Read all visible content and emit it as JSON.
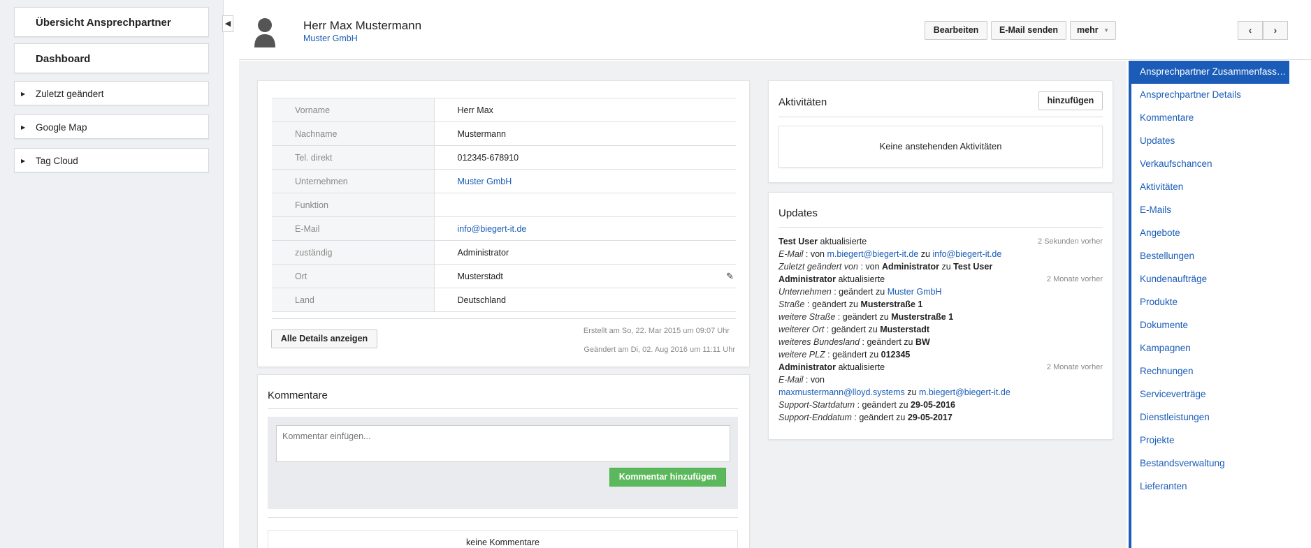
{
  "sidebar": {
    "overview": "Übersicht Ansprechpartner",
    "dashboard": "Dashboard",
    "items": [
      {
        "label": "Zuletzt geändert"
      },
      {
        "label": "Google Map"
      },
      {
        "label": "Tag Cloud"
      }
    ],
    "collapse_icon": "chevron-left-icon"
  },
  "header": {
    "name": "Herr Max Mustermann",
    "company": "Muster GmbH",
    "buttons": {
      "edit": "Bearbeiten",
      "email": "E-Mail senden",
      "more": "mehr"
    },
    "nav": {
      "prev": "‹",
      "next": "›"
    }
  },
  "details": {
    "rows": [
      {
        "key": "Vorname",
        "value": "Herr Max"
      },
      {
        "key": "Nachname",
        "value": "Mustermann"
      },
      {
        "key": "Tel. direkt",
        "value": "012345-678910"
      },
      {
        "key": "Unternehmen",
        "value": "Muster GmbH"
      },
      {
        "key": "Funktion",
        "value": ""
      },
      {
        "key": "E-Mail",
        "value": "info@biegert-it.de"
      },
      {
        "key": "zuständig",
        "value": "Administrator"
      },
      {
        "key": "Ort",
        "value": "Musterstadt"
      },
      {
        "key": "Land",
        "value": "Deutschland"
      }
    ],
    "show_all": "Alle Details anzeigen",
    "created": "Erstellt am So, 22. Mar 2015 um 09:07 Uhr",
    "modified": "Geändert am Di, 02. Aug 2016 um 11:11 Uhr"
  },
  "comments": {
    "title": "Kommentare",
    "placeholder": "Kommentar einfügen...",
    "add_button": "Kommentar hinzufügen",
    "empty": "keine Kommentare"
  },
  "activities": {
    "title": "Aktivitäten",
    "add": "hinzufügen",
    "empty": "Keine anstehenden Aktivitäten"
  },
  "updates": {
    "title": "Updates",
    "u1_user": "Test User",
    "u1_action": "aktualisierte",
    "u1_time": "2 Sekunden vorher",
    "u1_l1_field": "E-Mail",
    "u1_l1_text": "von",
    "u1_l1_from": "m.biegert@biegert-it.de",
    "u1_l1_to_word": "zu",
    "u1_l1_to": "info@biegert-it.de",
    "u1_l2_field": "Zuletzt geändert von",
    "u1_l2_text": "von",
    "u1_l2_from": "Administrator",
    "u1_l2_to_word": "zu",
    "u1_l2_to": "Test User",
    "u2_user": "Administrator",
    "u2_action": "aktualisierte",
    "u2_time": "2 Monate vorher",
    "u2_lines": [
      {
        "field": "Unternehmen",
        "text": "geändert zu",
        "value": "Muster GmbH"
      },
      {
        "field": "Straße",
        "text": "geändert zu",
        "value": "Musterstraße 1"
      },
      {
        "field": "weitere Straße",
        "text": "geändert zu",
        "value": "Musterstraße 1"
      },
      {
        "field": "weiterer Ort",
        "text": "geändert zu",
        "value": "Musterstadt"
      },
      {
        "field": "weiteres Bundesland",
        "text": "geändert zu",
        "value": "BW"
      },
      {
        "field": "weitere PLZ",
        "text": "geändert zu",
        "value": "012345"
      }
    ],
    "u3_user": "Administrator",
    "u3_action": "aktualisierte",
    "u3_time": "2 Monate vorher",
    "u3_l1_field": "E-Mail",
    "u3_l1_text": "von",
    "u3_l1_from": "maxmustermann@lloyd.systems",
    "u3_l1_to_word": "zu",
    "u3_l1_to": "m.biegert@biegert-it.de",
    "u3_lines": [
      {
        "field": "Support-Startdatum",
        "text": "geändert zu",
        "value": "29-05-2016"
      },
      {
        "field": "Support-Enddatum",
        "text": "geändert zu",
        "value": "29-05-2017"
      }
    ]
  },
  "right_nav": [
    "Ansprechpartner Zusammenfassu...",
    "Ansprechpartner Details",
    "Kommentare",
    "Updates",
    "Verkaufschancen",
    "Aktivitäten",
    "E-Mails",
    "Angebote",
    "Bestellungen",
    "Kundenaufträge",
    "Produkte",
    "Dokumente",
    "Kampagnen",
    "Rechnungen",
    "Serviceverträge",
    "Dienstleistungen",
    "Projekte",
    "Bestandsverwaltung",
    "Lieferanten"
  ],
  "colors": {
    "accent": "#1a5cb8",
    "green": "#5cb85c"
  }
}
